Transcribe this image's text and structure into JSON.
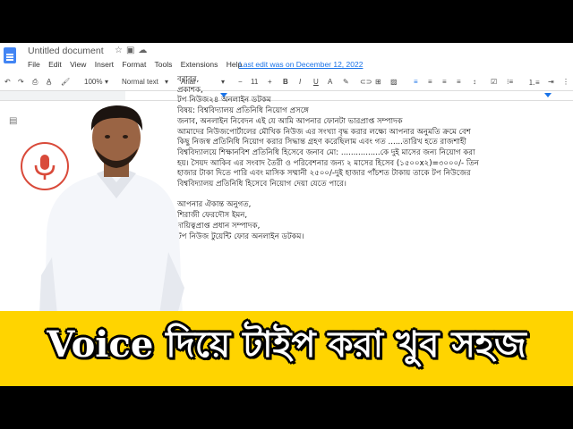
{
  "app": {
    "title": "Untitled document",
    "menus": [
      "File",
      "Edit",
      "View",
      "Insert",
      "Format",
      "Tools",
      "Extensions",
      "Help"
    ],
    "last_edit": "Last edit was on December 12, 2022"
  },
  "toolbar": {
    "zoom": "100%",
    "style": "Normal text",
    "font": "Arial",
    "size": "11"
  },
  "doc": {
    "lines": [
      "বরাবর,",
      "প্রকাশক,",
      " টপ নিউজ২৪ অনলাইন ডটকম",
      "বিষয়: বিশ্ববিদ্যালয় প্রতিনিধি নিয়োগ প্রসঙ্গে",
      "জনাব, অনলাইন নিবেদন এই যে আমি আপনার ফোনটা ভারপ্রাপ্ত সম্পাদক",
      "আমাদের নিউজপোর্টালের মৌখিক নিউজ এর সংখ্যা বৃদ্ধ করার লক্ষ্যে আপনার অনুমতি ক্রমে বেশ",
      "কিছু নিজস্ব প্রতিনিধি নিয়োগ করার সিদ্ধান্ত গ্রহণ করেছিলাম এবং গত ......তারিখ হতে রাজশাহী",
      "বিশ্ববিদ্যালয়ে শিক্ষানবিশ প্রতিনিধি হিসেবে জনাব মো: ................কে দুই মাসের জন্য নিয়োগ করা",
      "হয়। সৈয়দ আকিব এর সংবাদ তৈরী ও পরিবেশনার জন্য ২ মাসের হিসেব (১৫০০x২)=৩০০০/- তিন",
      "হাজার টাকা দিতে পারি এবং মাসিক সম্মানী ২৫০০/-দুই হাজার পাঁচশত টাকায় তাকে টপ নিউজের",
      "বিশ্ববিদ্যালয় প্রতিনিধি  হিসেবে নিয়োগ দেয়া যেতে পারে।",
      "",
      "আপনার ঐকান্ত অনুগত,",
      "শিরাজী ফেরদৌস ইমন,",
      "দায়িত্বপ্রাপ্ত প্রধান সম্পাদক,",
      "টপ নিউজ টুয়েন্টি ফোর অনলাইন ডটকম।"
    ]
  },
  "icons": {
    "doc": "google-docs-icon",
    "mic": "microphone-icon",
    "outline": "outline-icon"
  },
  "colors": {
    "banner": "#ffd400",
    "mic": "#d94a3a",
    "docs_blue": "#4285f4"
  },
  "banner": {
    "text": "Voice দিয়ে টাইপ করা খুব সহজ"
  }
}
